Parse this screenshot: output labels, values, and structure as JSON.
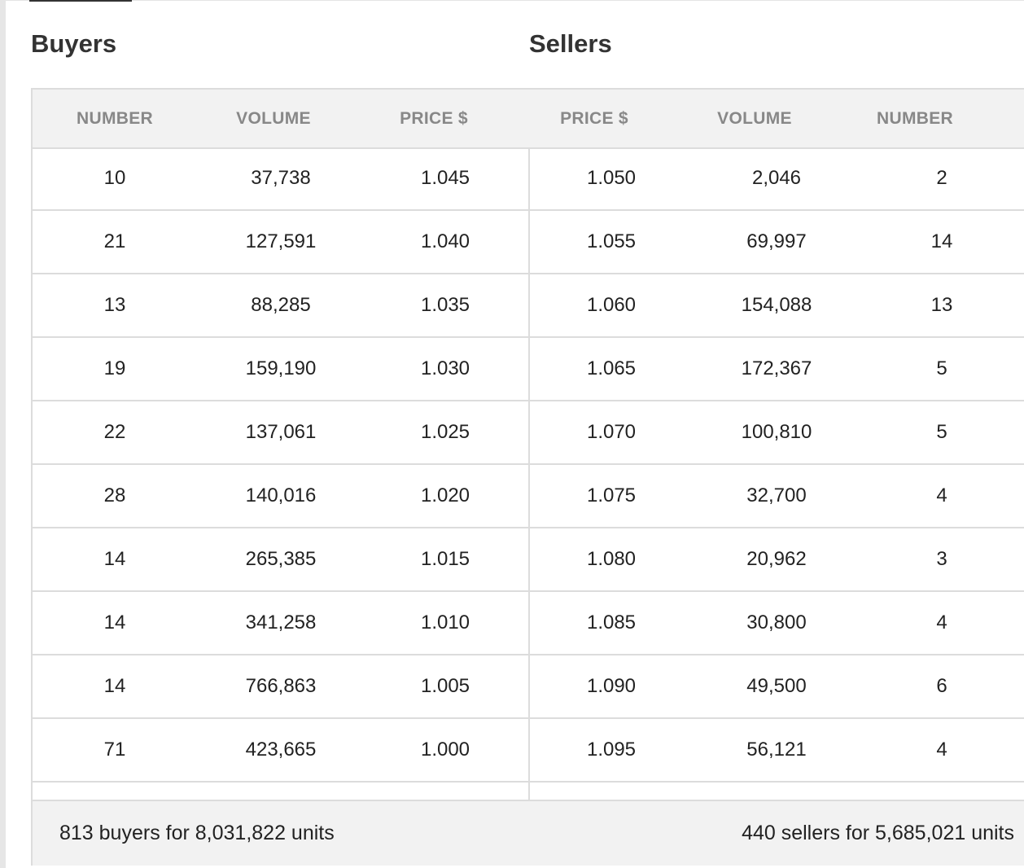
{
  "titles": {
    "buyers": "Buyers",
    "sellers": "Sellers"
  },
  "columns": [
    "NUMBER",
    "VOLUME",
    "PRICE $",
    "PRICE $",
    "VOLUME",
    "NUMBER"
  ],
  "rows": [
    {
      "buy_number": "10",
      "buy_volume": "37,738",
      "buy_price": "1.045",
      "sell_price": "1.050",
      "sell_volume": "2,046",
      "sell_number": "2"
    },
    {
      "buy_number": "21",
      "buy_volume": "127,591",
      "buy_price": "1.040",
      "sell_price": "1.055",
      "sell_volume": "69,997",
      "sell_number": "14"
    },
    {
      "buy_number": "13",
      "buy_volume": "88,285",
      "buy_price": "1.035",
      "sell_price": "1.060",
      "sell_volume": "154,088",
      "sell_number": "13"
    },
    {
      "buy_number": "19",
      "buy_volume": "159,190",
      "buy_price": "1.030",
      "sell_price": "1.065",
      "sell_volume": "172,367",
      "sell_number": "5"
    },
    {
      "buy_number": "22",
      "buy_volume": "137,061",
      "buy_price": "1.025",
      "sell_price": "1.070",
      "sell_volume": "100,810",
      "sell_number": "5"
    },
    {
      "buy_number": "28",
      "buy_volume": "140,016",
      "buy_price": "1.020",
      "sell_price": "1.075",
      "sell_volume": "32,700",
      "sell_number": "4"
    },
    {
      "buy_number": "14",
      "buy_volume": "265,385",
      "buy_price": "1.015",
      "sell_price": "1.080",
      "sell_volume": "20,962",
      "sell_number": "3"
    },
    {
      "buy_number": "14",
      "buy_volume": "341,258",
      "buy_price": "1.010",
      "sell_price": "1.085",
      "sell_volume": "30,800",
      "sell_number": "4"
    },
    {
      "buy_number": "14",
      "buy_volume": "766,863",
      "buy_price": "1.005",
      "sell_price": "1.090",
      "sell_volume": "49,500",
      "sell_number": "6"
    },
    {
      "buy_number": "71",
      "buy_volume": "423,665",
      "buy_price": "1.000",
      "sell_price": "1.095",
      "sell_volume": "56,121",
      "sell_number": "4"
    }
  ],
  "footer": {
    "buyers_summary": "813 buyers for 8,031,822 units",
    "sellers_summary": "440 sellers for 5,685,021 units"
  },
  "colors": {
    "header_background": "#f2f2f2",
    "grid_line": "#dcdcdc",
    "header_text": "#888888",
    "body_text": "#222222"
  }
}
